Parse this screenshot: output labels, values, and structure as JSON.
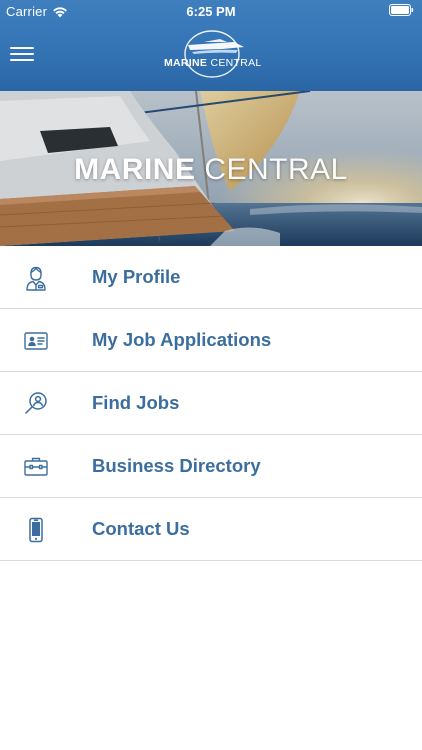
{
  "status_bar": {
    "carrier": "Carrier",
    "time": "6:25 PM"
  },
  "header": {
    "logo_word_bold": "MARINE",
    "logo_word_light": "CENTRAL"
  },
  "hero": {
    "title_bold": "MARINE",
    "title_light": "CENTRAL"
  },
  "menu": {
    "items": [
      {
        "label": "My Profile",
        "icon": "profile-icon"
      },
      {
        "label": "My Job Applications",
        "icon": "id-card-icon"
      },
      {
        "label": "Find Jobs",
        "icon": "search-person-icon"
      },
      {
        "label": "Business Directory",
        "icon": "briefcase-icon"
      },
      {
        "label": "Contact Us",
        "icon": "phone-icon"
      }
    ]
  },
  "colors": {
    "header": "#3575b6",
    "menu_text": "#3b6e9e",
    "divider": "#d9d9d9"
  }
}
